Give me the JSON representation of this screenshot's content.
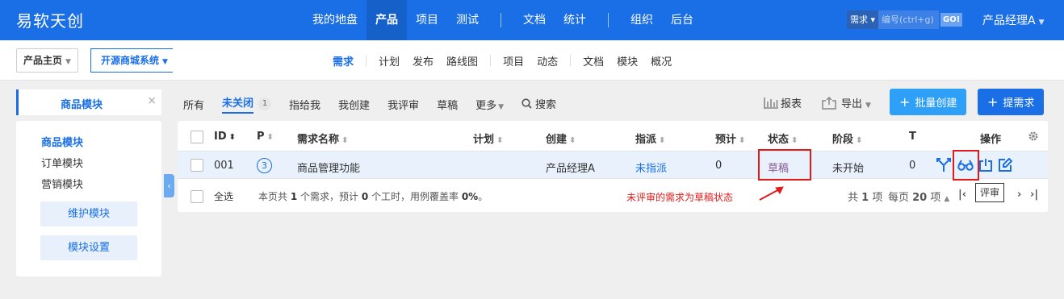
{
  "topbar": {
    "brand": "易软天创",
    "nav": [
      "我的地盘",
      "产品",
      "项目",
      "测试",
      "文档",
      "统计",
      "组织",
      "后台"
    ],
    "search_type": "需求 ▾",
    "search_placeholder": "编号(ctrl+g)",
    "go": "GO!",
    "user": "产品经理A"
  },
  "subbar": {
    "crumb_home": "产品主页",
    "crumb_product": "开源商城系统",
    "nav": [
      "需求",
      "计划",
      "发布",
      "路线图",
      "项目",
      "动态",
      "文档",
      "模块",
      "概况"
    ]
  },
  "sidebar": {
    "tab_label": "商品模块",
    "close": "×",
    "modules": [
      "商品模块",
      "订单模块",
      "营销模块"
    ],
    "maintain_button": "维护模块",
    "settings_button": "模块设置",
    "toggle": "‹"
  },
  "filters": {
    "all": "所有",
    "open": "未关闭",
    "open_count": "1",
    "assigned": "指给我",
    "created": "我创建",
    "reviewed": "我评审",
    "draft": "草稿",
    "more": "更多",
    "search": "搜索"
  },
  "toolbar": {
    "report": "报表",
    "export": "导出",
    "batch_create": "批量创建",
    "create": "提需求"
  },
  "table": {
    "headers": [
      "ID",
      "P",
      "需求名称",
      "计划",
      "创建",
      "指派",
      "预计",
      "状态",
      "阶段",
      "T",
      "操作"
    ],
    "row": {
      "id": "001",
      "priority": "3",
      "name": "商品管理功能",
      "plan": "",
      "creator": "产品经理A",
      "assignee": "未指派",
      "estimate": "0",
      "status": "草稿",
      "stage": "未开始",
      "t": "0"
    },
    "footer": {
      "select_all": "全选",
      "summary_pre": "本页共 ",
      "count": "1",
      "summary_mid1": " 个需求，预计 ",
      "hours": "0",
      "summary_mid2": " 个工时，用例覆盖率 ",
      "coverage": "0%",
      "summary_end": "。"
    },
    "annotation": "未评审的需求为草稿状态",
    "tooltip": "评审",
    "pager": {
      "total_pre": "共 ",
      "total": "1",
      "total_post": " 项",
      "per_page_pre": "每页 ",
      "per_page": "20",
      "per_page_post": " 项"
    }
  },
  "colors": {
    "primary": "#1a6fe6",
    "light_blue": "#2fa0f7",
    "annotation_red": "#e01b1b"
  }
}
